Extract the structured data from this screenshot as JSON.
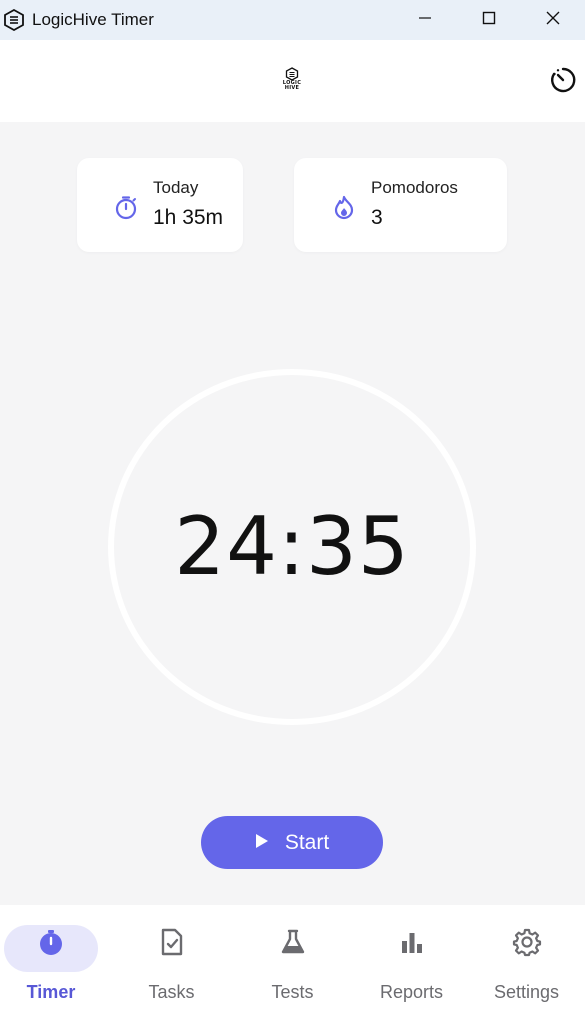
{
  "window": {
    "title": "LogicHive Timer",
    "controls": {
      "minimize": "minimize-icon",
      "maximize": "maximize-icon",
      "close": "close-icon"
    }
  },
  "header": {
    "logo": {
      "line1": "LOGIC",
      "line2": "HIVE"
    },
    "action_icon": "timer-history-icon"
  },
  "stats": {
    "today": {
      "label": "Today",
      "value": "1h 35m",
      "icon": "stopwatch-icon"
    },
    "pomodoros": {
      "label": "Pomodoros",
      "value": "3",
      "icon": "flame-icon"
    }
  },
  "timer": {
    "display": "24:35"
  },
  "start_button": {
    "label": "Start",
    "icon": "play-icon"
  },
  "nav": {
    "items": [
      {
        "label": "Timer",
        "icon": "stopwatch-icon",
        "active": true
      },
      {
        "label": "Tasks",
        "icon": "task-check-icon",
        "active": false
      },
      {
        "label": "Tests",
        "icon": "flask-icon",
        "active": false
      },
      {
        "label": "Reports",
        "icon": "bar-chart-icon",
        "active": false
      },
      {
        "label": "Settings",
        "icon": "gear-icon",
        "active": false
      }
    ]
  },
  "colors": {
    "accent": "#6466e9",
    "accent_light": "#e7e7fb",
    "background": "#f5f5f6",
    "titlebar": "#e9f0f8"
  }
}
